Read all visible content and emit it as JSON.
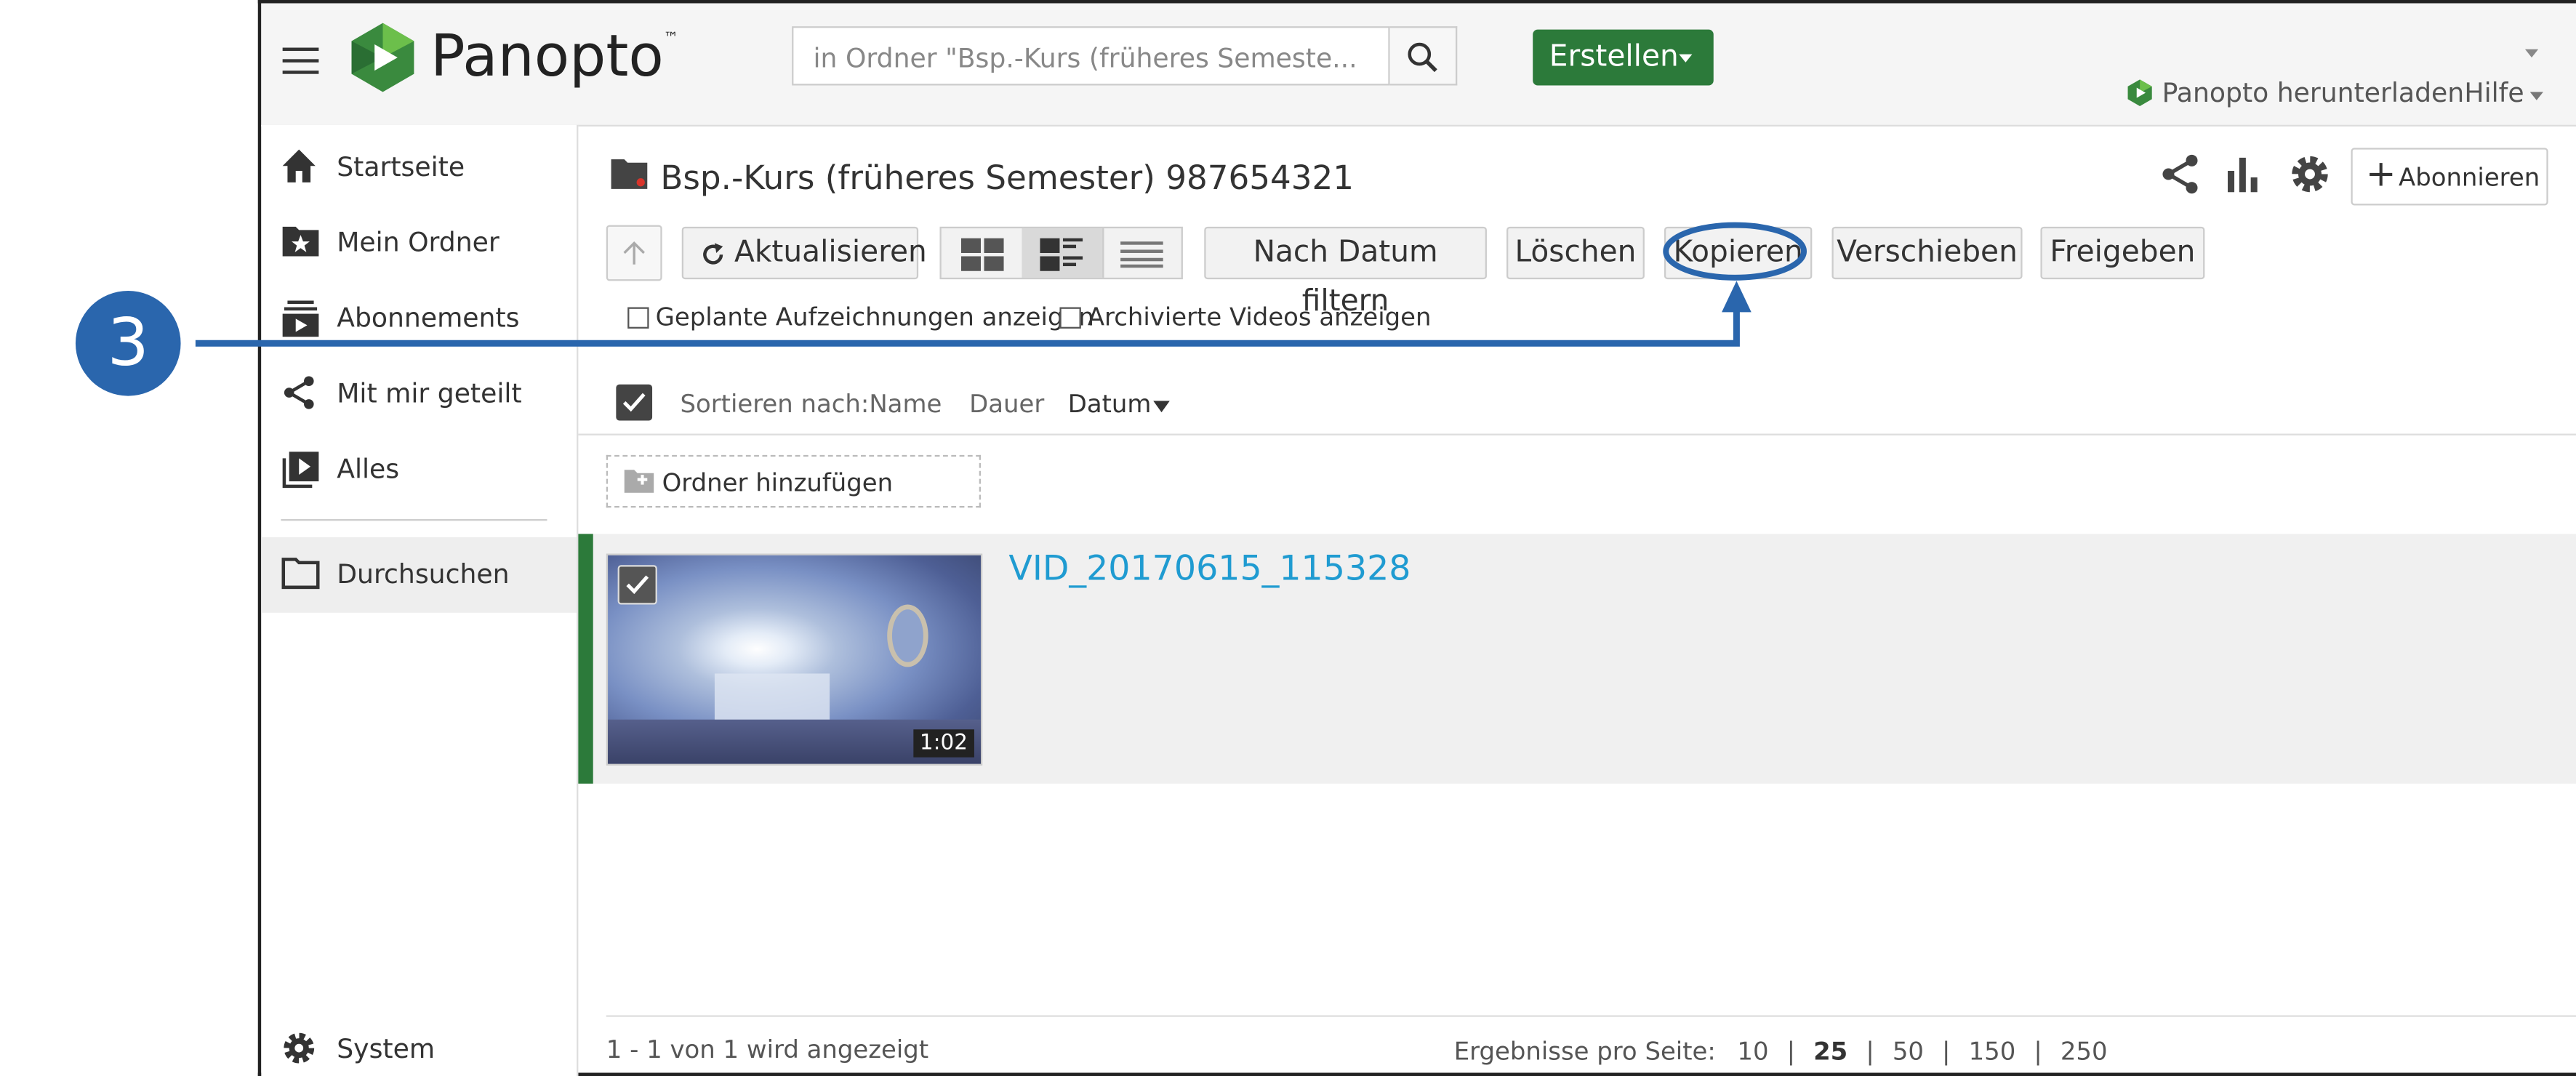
{
  "callout": {
    "number": "3",
    "color": "#2a66ad"
  },
  "header": {
    "logo_text": "Panopto",
    "logo_tm": "™",
    "search_placeholder": "in Ordner \"Bsp.-Kurs (früheres Semeste...",
    "create_label": "Erstellen",
    "download_label": "Panopto herunterladen",
    "help_label": "Hilfe",
    "brand_green": "#2c7a3a"
  },
  "sidebar": {
    "items": [
      {
        "label": "Startseite",
        "icon": "home-icon"
      },
      {
        "label": "Mein Ordner",
        "icon": "star-folder-icon"
      },
      {
        "label": "Abonnements",
        "icon": "subscriptions-icon"
      },
      {
        "label": "Mit mir geteilt",
        "icon": "share-icon"
      },
      {
        "label": "Alles",
        "icon": "video-library-icon"
      }
    ],
    "browse_label": "Durchsuchen",
    "system_label": "System"
  },
  "folder": {
    "title": "Bsp.-Kurs (früheres Semester) 987654321",
    "subscribe_label": "Abonnieren"
  },
  "toolbar": {
    "refresh_label": "Aktualisieren",
    "filter_date_label": "Nach Datum filtern",
    "delete_label": "Löschen",
    "copy_label": "Kopieren",
    "move_label": "Verschieben",
    "share_label": "Freigeben"
  },
  "options": {
    "scheduled_label": "Geplante Aufzeichnungen anzeigen",
    "archived_label": "Archivierte Videos anzeigen"
  },
  "sort": {
    "label": "Sortieren nach:",
    "name": "Name",
    "duration": "Dauer",
    "date": "Datum"
  },
  "add_folder_label": "Ordner hinzufügen",
  "session": {
    "title": "VID_20170615_115328",
    "duration": "1:02",
    "selected": true
  },
  "footer": {
    "count_text": "1 - 1 von 1 wird angezeigt",
    "per_page_label": "Ergebnisse pro Seite:",
    "options": [
      "10",
      "25",
      "50",
      "150",
      "250"
    ],
    "selected": "25",
    "separator": "|"
  }
}
